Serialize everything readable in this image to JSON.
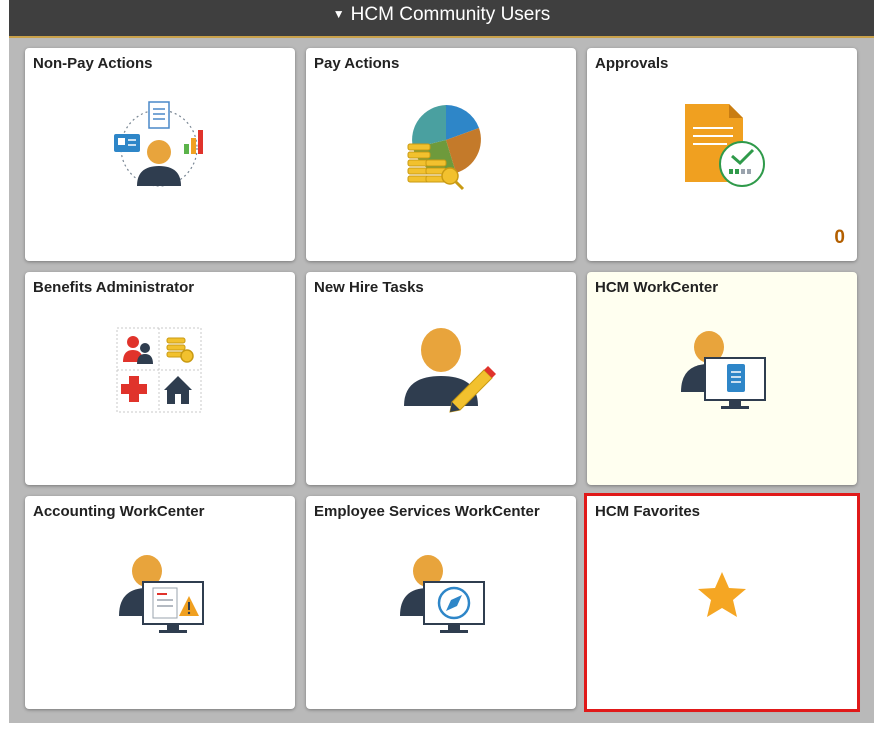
{
  "header": {
    "caret": "▼",
    "title": "HCM Community Users"
  },
  "tiles": [
    {
      "title": "Non-Pay Actions",
      "icon": "person-documents-chart-icon"
    },
    {
      "title": "Pay Actions",
      "icon": "pie-chart-coins-icon"
    },
    {
      "title": "Approvals",
      "icon": "document-checkmark-icon",
      "count": "0"
    },
    {
      "title": "Benefits Administrator",
      "icon": "benefits-grid-icon"
    },
    {
      "title": "New Hire Tasks",
      "icon": "person-pencil-icon"
    },
    {
      "title": "HCM WorkCenter",
      "icon": "person-monitor-document-icon"
    },
    {
      "title": "Accounting WorkCenter",
      "icon": "person-monitor-warning-icon"
    },
    {
      "title": "Employee Services WorkCenter",
      "icon": "person-monitor-compass-icon"
    },
    {
      "title": "HCM Favorites",
      "icon": "star-icon"
    }
  ],
  "colors": {
    "header_bg": "#3f3f3f",
    "selected_outline": "#e01919",
    "count_color": "#b35f00",
    "star": "#f5a623"
  }
}
